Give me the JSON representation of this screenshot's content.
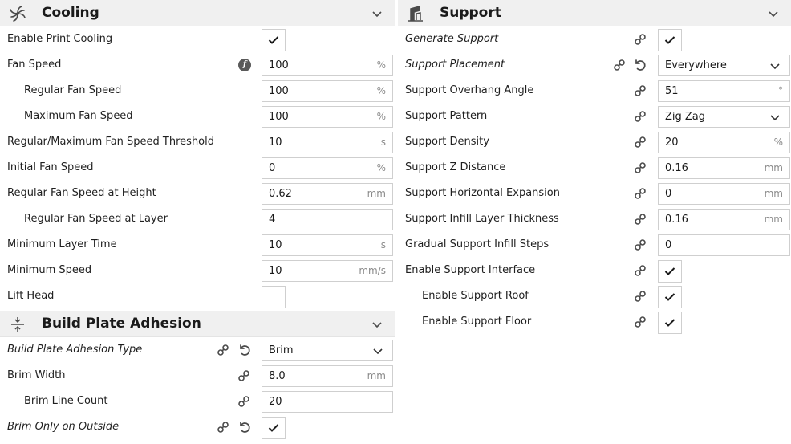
{
  "cooling": {
    "title": "Cooling",
    "rows": [
      {
        "label": "Enable Print Cooling",
        "type": "check",
        "checked": true
      },
      {
        "label": "Fan Speed",
        "type": "input",
        "value": "100",
        "unit": "%",
        "fx": true
      },
      {
        "label": "Regular Fan Speed",
        "type": "input",
        "value": "100",
        "unit": "%",
        "indent": true
      },
      {
        "label": "Maximum Fan Speed",
        "type": "input",
        "value": "100",
        "unit": "%",
        "indent": true
      },
      {
        "label": "Regular/Maximum Fan Speed Threshold",
        "type": "input",
        "value": "10",
        "unit": "s"
      },
      {
        "label": "Initial Fan Speed",
        "type": "input",
        "value": "0",
        "unit": "%"
      },
      {
        "label": "Regular Fan Speed at Height",
        "type": "input",
        "value": "0.62",
        "unit": "mm"
      },
      {
        "label": "Regular Fan Speed at Layer",
        "type": "input",
        "value": "4",
        "unit": "",
        "indent": true
      },
      {
        "label": "Minimum Layer Time",
        "type": "input",
        "value": "10",
        "unit": "s"
      },
      {
        "label": "Minimum Speed",
        "type": "input",
        "value": "10",
        "unit": "mm/s"
      },
      {
        "label": "Lift Head",
        "type": "check",
        "checked": false
      }
    ]
  },
  "adhesion": {
    "title": "Build Plate Adhesion",
    "rows": [
      {
        "label": "Build Plate Adhesion Type",
        "type": "select",
        "value": "Brim",
        "italic": true,
        "link": true,
        "reset": true
      },
      {
        "label": "Brim Width",
        "type": "input",
        "value": "8.0",
        "unit": "mm",
        "link": true
      },
      {
        "label": "Brim Line Count",
        "type": "input",
        "value": "20",
        "unit": "",
        "indent": true,
        "link": true
      },
      {
        "label": "Brim Only on Outside",
        "type": "check",
        "checked": true,
        "italic": true,
        "link": true,
        "reset": true
      }
    ]
  },
  "support": {
    "title": "Support",
    "rows": [
      {
        "label": "Generate Support",
        "type": "check",
        "checked": true,
        "italic": true,
        "link": true
      },
      {
        "label": "Support Placement",
        "type": "select",
        "value": "Everywhere",
        "italic": true,
        "link": true,
        "reset": true
      },
      {
        "label": "Support Overhang Angle",
        "type": "input",
        "value": "51",
        "unit": "°",
        "link": true
      },
      {
        "label": "Support Pattern",
        "type": "select",
        "value": "Zig Zag",
        "link": true
      },
      {
        "label": "Support Density",
        "type": "input",
        "value": "20",
        "unit": "%",
        "link": true
      },
      {
        "label": "Support Z Distance",
        "type": "input",
        "value": "0.16",
        "unit": "mm",
        "link": true
      },
      {
        "label": "Support Horizontal Expansion",
        "type": "input",
        "value": "0",
        "unit": "mm",
        "link": true
      },
      {
        "label": "Support Infill Layer Thickness",
        "type": "input",
        "value": "0.16",
        "unit": "mm",
        "link": true
      },
      {
        "label": "Gradual Support Infill Steps",
        "type": "input",
        "value": "0",
        "unit": "",
        "link": true
      },
      {
        "label": "Enable Support Interface",
        "type": "check",
        "checked": true,
        "link": true
      },
      {
        "label": "Enable Support Roof",
        "type": "check",
        "checked": true,
        "indent": true,
        "link": true
      },
      {
        "label": "Enable Support Floor",
        "type": "check",
        "checked": true,
        "indent": true,
        "link": true
      }
    ]
  },
  "icons": {
    "cooling": "fan-icon",
    "adhesion": "adhesion-icon",
    "support": "support-icon",
    "collapse": "chevron-down-icon",
    "link": "link-icon",
    "reset": "reset-icon",
    "function": "function-icon",
    "check": "checkmark-icon"
  },
  "colors": {
    "header_bg": "#f0f0f0",
    "border": "#cfcfcf",
    "unit": "#8a8a8a",
    "icon": "#4a4a4a"
  }
}
